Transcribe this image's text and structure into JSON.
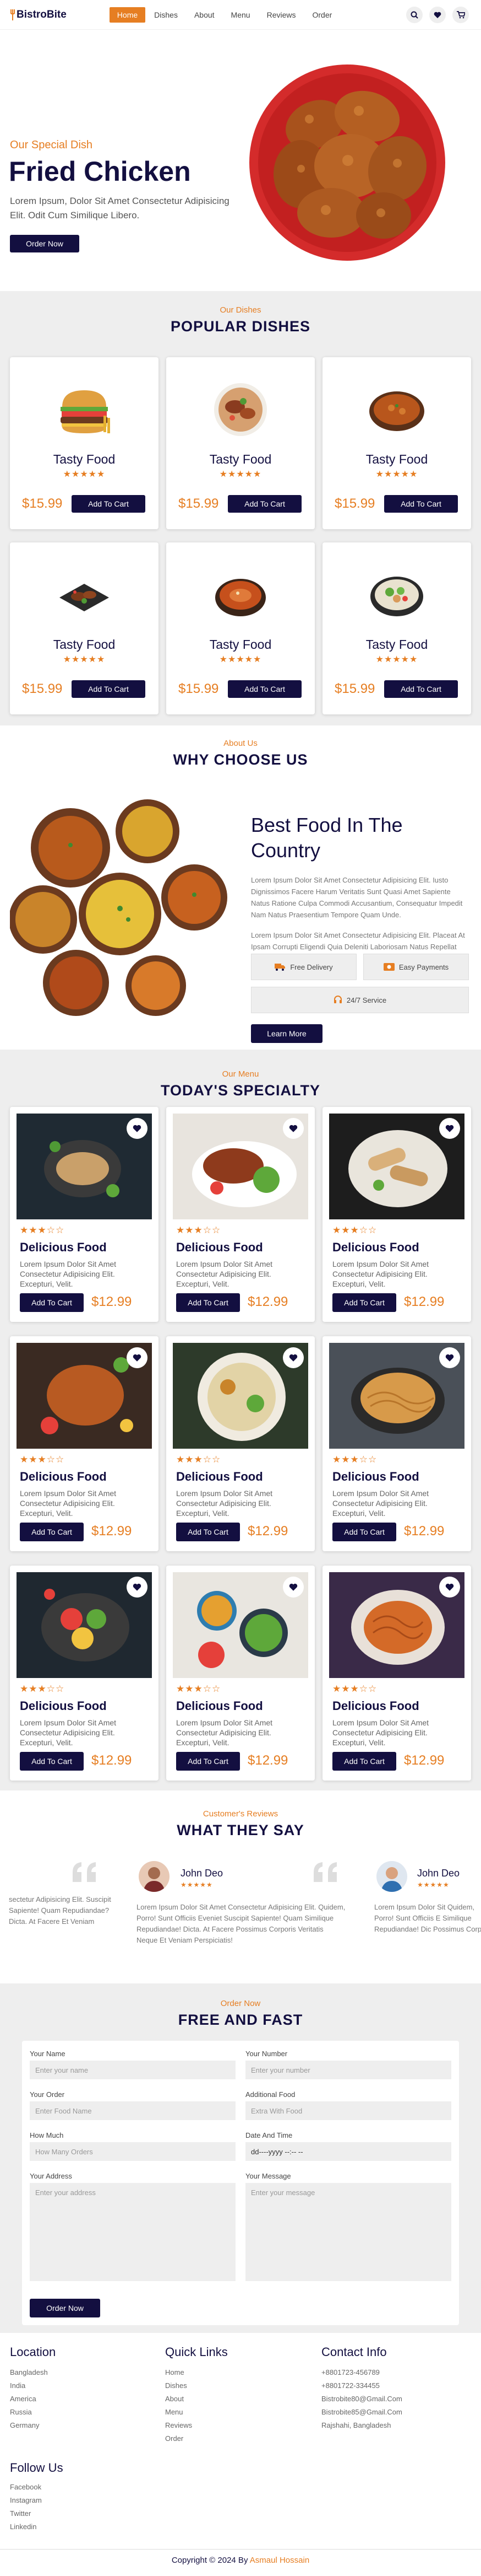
{
  "brand": "BistroBite",
  "nav": [
    "Home",
    "Dishes",
    "About",
    "Menu",
    "Reviews",
    "Order"
  ],
  "home": {
    "subtitle": "Our Special Dish",
    "title": "Fried Chicken",
    "text": "Lorem Ipsum, Dolor Sit Amet Consectetur Adipisicing Elit. Odit Cum Similique Libero.",
    "button": "Order Now"
  },
  "dishes": {
    "subtitle": "Our Dishes",
    "title": "POPULAR DISHES",
    "items": [
      {
        "name": "Tasty Food",
        "price": "$15.99",
        "button": "Add To Cart",
        "stars": "★★★★★",
        "rating": 4.5,
        "icon": "burger"
      },
      {
        "name": "Tasty Food",
        "price": "$15.99",
        "button": "Add To Cart",
        "stars": "★★★★★",
        "rating": 4.5,
        "icon": "grilled-plate"
      },
      {
        "name": "Tasty Food",
        "price": "$15.99",
        "button": "Add To Cart",
        "stars": "★★★★★",
        "rating": 4.5,
        "icon": "curry-bowl"
      },
      {
        "name": "Tasty Food",
        "price": "$15.99",
        "button": "Add To Cart",
        "stars": "★★★★★",
        "rating": 4.5,
        "icon": "meat-plate"
      },
      {
        "name": "Tasty Food",
        "price": "$15.99",
        "button": "Add To Cart",
        "stars": "★★★★★",
        "rating": 4.5,
        "icon": "soup-bowl"
      },
      {
        "name": "Tasty Food",
        "price": "$15.99",
        "button": "Add To Cart",
        "stars": "★★★★★",
        "rating": 4.5,
        "icon": "salad-bowl"
      }
    ]
  },
  "about": {
    "subtitle": "About Us",
    "title": "WHY CHOOSE US",
    "heading": "Best Food In The Country",
    "p1": "Lorem Ipsum Dolor Sit Amet Consectetur Adipisicing Elit. Iusto Dignissimos Facere Harum Veritatis Sunt Quasi Amet Sapiente Natus Ratione Culpa Commodi Accusantium, Consequatur Impedit Nam Natus Praesentium Tempore Quam Unde.",
    "p2": "Lorem Ipsum Dolor Sit Amet Consectetur Adipisicing Elit. Placeat At Ipsam Corrupti Eligendi Quia Deleniti Laboriosam Natus Repellat Facilis Repudiandae?",
    "features": [
      "Free Delivery",
      "Easy Payments",
      "24/7 Service"
    ],
    "button": "Learn More"
  },
  "menu": {
    "subtitle": "Our Menu",
    "title": "TODAY'S SPECIALTY",
    "item": {
      "name": "Delicious Food",
      "text": "Lorem Ipsum Dolor Sit Amet Consectetur Adipisicing Elit. Excepturi, Velit.",
      "price": "$12.99",
      "button": "Add To Cart",
      "stars": "★★★☆☆",
      "rating": 3.5
    },
    "images": [
      "dark-fish",
      "roast-meat",
      "wraps",
      "roast-chicken",
      "rice-bowl",
      "noodles",
      "veg-bowl",
      "colorful-bowls",
      "pasta"
    ]
  },
  "reviews": {
    "subtitle": "Customer's Reviews",
    "title": "WHAT THEY SAY",
    "left_text": "sectetur Adipisicing Elit. Suscipit Sapiente! Quam Repudiandae? Dicta. At Facere Et Veniam Perspiciatis!",
    "center": {
      "name": "John Deo",
      "stars": "★★★★★",
      "text": "Lorem Ipsum Dolor Sit Amet Consectetur Adipisicing Elit. Quidem, Porro! Sunt Officiis Eveniet Suscipit Sapiente! Quam Similique Repudiandae! Dicta. At Facere Possimus Corporis Veritatis Neque Et Veniam Perspiciatis!"
    },
    "right": {
      "name": "John Deo",
      "stars": "★★★★★",
      "text": "Lorem Ipsum Dolor Sit Quidem, Porro! Sunt Officiis E Similique Repudiandae! Dic Possimus Corporis Veritatis N"
    }
  },
  "order": {
    "subtitle": "Order Now",
    "title": "FREE AND FAST",
    "fields": {
      "name": {
        "label": "Your Name",
        "placeholder": "Enter your name"
      },
      "number": {
        "label": "Your Number",
        "placeholder": "Enter your number"
      },
      "order": {
        "label": "Your Order",
        "placeholder": "Enter Food Name"
      },
      "additional": {
        "label": "Additional Food",
        "placeholder": "Extra With Food"
      },
      "howmuch": {
        "label": "How Much",
        "placeholder": "How Many Orders"
      },
      "datetime": {
        "label": "Date And Time",
        "placeholder": "dd----yyyy --:-- --"
      },
      "address": {
        "label": "Your Address",
        "placeholder": "Enter your address"
      },
      "message": {
        "label": "Your Message",
        "placeholder": "Enter your message"
      }
    },
    "button": "Order Now"
  },
  "footer": {
    "location": {
      "title": "Location",
      "items": [
        "Bangladesh",
        "India",
        "America",
        "Russia",
        "Germany"
      ]
    },
    "links": {
      "title": "Quick Links",
      "items": [
        "Home",
        "Dishes",
        "About",
        "Menu",
        "Reviews",
        "Order"
      ]
    },
    "contact": {
      "title": "Contact Info",
      "items": [
        "+8801723-456789",
        "+8801722-334455",
        "Bistrobite80@Gmail.Com",
        "Bistrobite85@Gmail.Com",
        "Rajshahi, Bangladesh"
      ]
    },
    "follow": {
      "title": "Follow Us",
      "items": [
        "Facebook",
        "Instagram",
        "Twitter",
        "Linkedin"
      ]
    },
    "copyright_prefix": "Copyright © 2024 By ",
    "copyright_name": "Asmaul Hossain"
  },
  "colors": {
    "primary": "#130f40",
    "accent": "#e67e22",
    "bg_grey": "#eeeeee"
  }
}
